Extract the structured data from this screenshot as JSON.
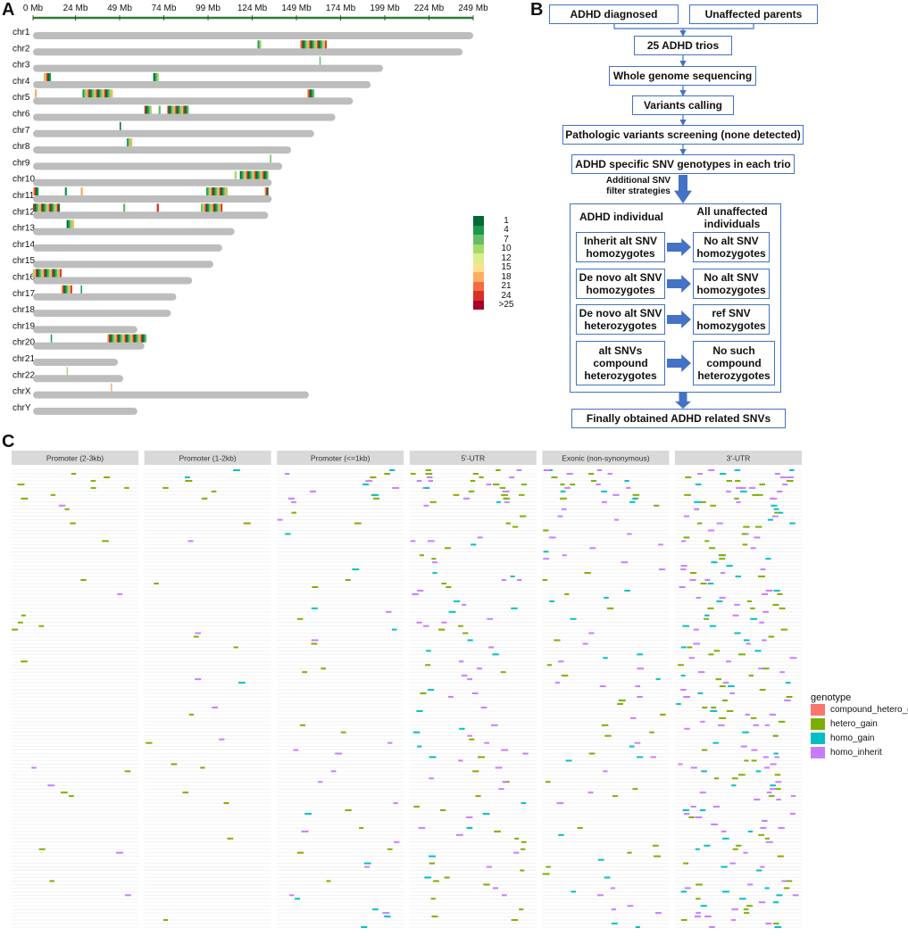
{
  "panels": {
    "a": "A",
    "b": "B",
    "c": "C"
  },
  "panel_a": {
    "axis_ticks": [
      "0 Mb",
      "24 Mb",
      "49 Mb",
      "74 Mb",
      "99 Mb",
      "124 Mb",
      "149 Mb",
      "174 Mb",
      "199 Mb",
      "224 Mb",
      "249 Mb"
    ],
    "tick_values": [
      0,
      24,
      49,
      74,
      99,
      124,
      149,
      174,
      199,
      224,
      249
    ],
    "chromosomes": [
      {
        "name": "chr1",
        "length": 249,
        "bands": []
      },
      {
        "name": "chr2",
        "length": 243,
        "bands": [
          [
            127,
            2
          ],
          [
            151,
            15
          ]
        ]
      },
      {
        "name": "chr3",
        "length": 198,
        "bands": [
          [
            162,
            0.6
          ]
        ]
      },
      {
        "name": "chr4",
        "length": 191,
        "bands": [
          [
            6,
            4
          ],
          [
            68,
            3
          ]
        ]
      },
      {
        "name": "chr5",
        "length": 181,
        "bands": [
          [
            1,
            1
          ],
          [
            28,
            17
          ],
          [
            155,
            4
          ]
        ]
      },
      {
        "name": "chr6",
        "length": 171,
        "bands": [
          [
            63,
            4
          ],
          [
            71,
            1
          ],
          [
            76,
            12
          ]
        ]
      },
      {
        "name": "chr7",
        "length": 159,
        "bands": [
          [
            49,
            0.6
          ]
        ]
      },
      {
        "name": "chr8",
        "length": 146,
        "bands": [
          [
            53,
            3
          ]
        ]
      },
      {
        "name": "chr9",
        "length": 141,
        "bands": [
          [
            134,
            0.6
          ]
        ]
      },
      {
        "name": "chr10",
        "length": 135,
        "bands": [
          [
            114,
            1
          ],
          [
            117,
            16
          ]
        ]
      },
      {
        "name": "chr11",
        "length": 135,
        "bands": [
          [
            0,
            3
          ],
          [
            18,
            1
          ],
          [
            27,
            1
          ],
          [
            98,
            12
          ],
          [
            131,
            2
          ]
        ]
      },
      {
        "name": "chr12",
        "length": 133,
        "bands": [
          [
            0,
            15
          ],
          [
            51,
            1
          ],
          [
            70,
            1
          ],
          [
            95,
            12
          ]
        ]
      },
      {
        "name": "chr13",
        "length": 114,
        "bands": [
          [
            19,
            4
          ]
        ]
      },
      {
        "name": "chr14",
        "length": 107,
        "bands": []
      },
      {
        "name": "chr15",
        "length": 102,
        "bands": []
      },
      {
        "name": "chr16",
        "length": 90,
        "bands": [
          [
            0,
            16
          ]
        ]
      },
      {
        "name": "chr17",
        "length": 81,
        "bands": [
          [
            16,
            6
          ],
          [
            27,
            0.6
          ]
        ]
      },
      {
        "name": "chr18",
        "length": 78,
        "bands": []
      },
      {
        "name": "chr19",
        "length": 59,
        "bands": []
      },
      {
        "name": "chr20",
        "length": 63,
        "bands": [
          [
            10,
            0.6
          ],
          [
            42,
            22
          ]
        ]
      },
      {
        "name": "chr21",
        "length": 48,
        "bands": []
      },
      {
        "name": "chr22",
        "length": 51,
        "bands": [
          [
            19,
            0.6
          ]
        ]
      },
      {
        "name": "chrX",
        "length": 156,
        "bands": [
          [
            44,
            0.6
          ]
        ]
      },
      {
        "name": "chrY",
        "length": 59,
        "bands": []
      }
    ],
    "heat_legend": [
      {
        "label": "1",
        "color": "#006837"
      },
      {
        "label": "4",
        "color": "#1a9850"
      },
      {
        "label": "7",
        "color": "#66bd63"
      },
      {
        "label": "10",
        "color": "#a6d96a"
      },
      {
        "label": "12",
        "color": "#d9ef8b"
      },
      {
        "label": "15",
        "color": "#fee08b"
      },
      {
        "label": "18",
        "color": "#fdae61"
      },
      {
        "label": "21",
        "color": "#f46d43"
      },
      {
        "label": "24",
        "color": "#d73027"
      },
      {
        "label": ">25",
        "color": "#a50026"
      }
    ]
  },
  "panel_b": {
    "adhd_diagnosed": "ADHD diagnosed",
    "unaffected_parents": "Unaffected parents",
    "trios": "25 ADHD trios",
    "wgs": "Whole genome sequencing",
    "variant_calling": "Variants calling",
    "pathologic": "Pathologic variants screening (none detected)",
    "specific": "ADHD specific SNV genotypes in each trio",
    "filter_note_1": "Additional SNV",
    "filter_note_2": "filter strategies",
    "adhd_individual": "ADHD individual",
    "unaffected_1": "All unaffected",
    "unaffected_2": "individuals",
    "rows": [
      {
        "left1": "Inherit alt SNV",
        "left2": "homozygotes",
        "right1": "No alt SNV",
        "right2": "homozygotes",
        "right3": ""
      },
      {
        "left1": "De novo alt SNV",
        "left2": "homozygotes",
        "right1": "No alt SNV",
        "right2": "homozygotes",
        "right3": ""
      },
      {
        "left1": "De novo alt SNV",
        "left2": "heterozygotes",
        "right1": "ref SNV",
        "right2": "homozygotes",
        "right3": ""
      },
      {
        "left1": "alt SNVs",
        "left2": "compound",
        "left3": "heterozygotes",
        "right1": "No such",
        "right2": "compound",
        "right3": "heterozygotes"
      }
    ],
    "final": "Finally obtained ADHD related SNVs"
  },
  "panel_c": {
    "facets": [
      "Promoter (2-3kb)",
      "Promoter (1-2kb)",
      "Promoter (<=1kb)",
      "5'-UTR",
      "Exonic (non-synonymous)",
      "3'-UTR"
    ],
    "facet_densities": [
      0.18,
      0.16,
      0.24,
      0.42,
      0.38,
      0.68
    ],
    "legend_title": "genotype",
    "legend": [
      {
        "label": "compound_hetero_gain",
        "color": "#f8766d"
      },
      {
        "label": "hetero_gain",
        "color": "#7cae00"
      },
      {
        "label": "homo_gain",
        "color": "#00bfc4"
      },
      {
        "label": "homo_inherit",
        "color": "#c77cff"
      }
    ]
  },
  "colors": {
    "accent": "#4472c4",
    "chrom": "#bdbdbd",
    "axis": "#2e7d32",
    "facet_strip": "#d9d9d9"
  }
}
